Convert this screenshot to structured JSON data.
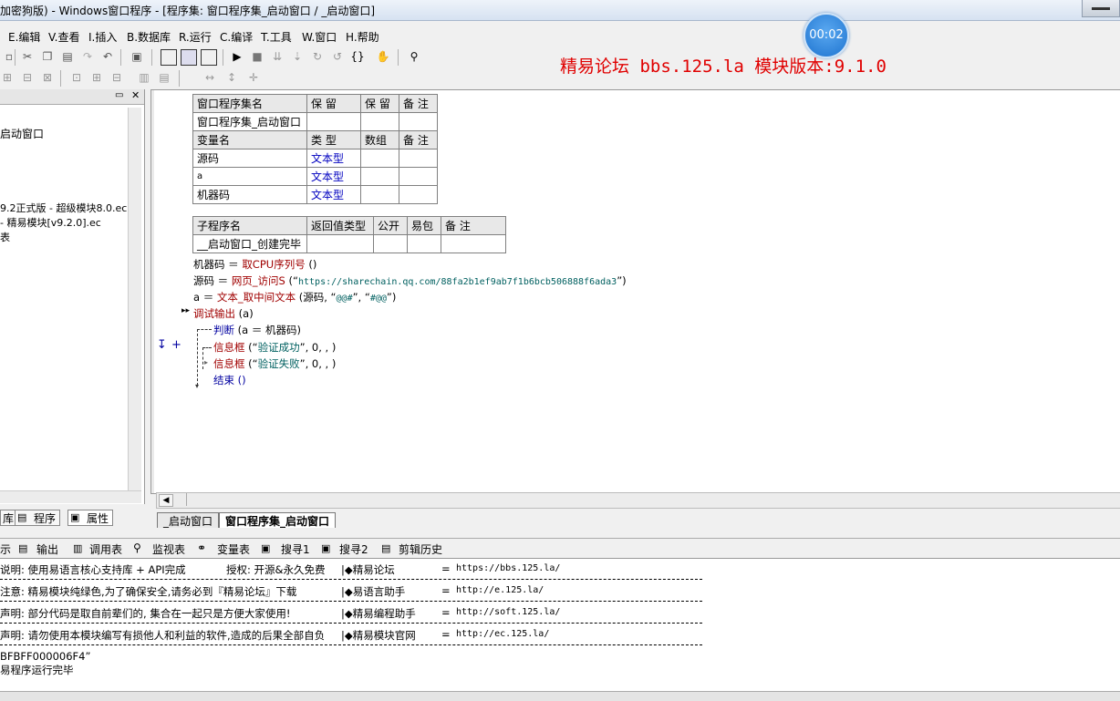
{
  "window": {
    "title": "加密狗版) - Windows窗口程序 - [程序集: 窗口程序集_启动窗口 / _启动窗口]"
  },
  "timer": "00:02",
  "menu": [
    "E.编辑",
    "V.查看",
    "I.插入",
    "B.数据库",
    "R.运行",
    "C.编译",
    "T.工具",
    "W.窗口",
    "H.帮助"
  ],
  "banner": "精易论坛 bbs.125.la 模块版本:9.1.0",
  "left_panel": {
    "lines": [
      "启动窗口",
      "9.2正式版 - 超级模块8.0.ec",
      " - 精易模块[v9.2.0].ec",
      "表"
    ],
    "tabs": [
      "库",
      "程序",
      "属性"
    ]
  },
  "editor": {
    "assembly_table": {
      "header": [
        "窗口程序集名",
        "保 留",
        "保 留",
        "备 注"
      ],
      "row": [
        "窗口程序集_启动窗口",
        "",
        "",
        ""
      ]
    },
    "var_table": {
      "header": [
        "变量名",
        "类 型",
        "数组",
        "备 注"
      ],
      "rows": [
        [
          "源码",
          "文本型",
          "",
          ""
        ],
        [
          "a",
          "文本型",
          "",
          ""
        ],
        [
          "机器码",
          "文本型",
          "",
          ""
        ]
      ]
    },
    "sub_table": {
      "header": [
        "子程序名",
        "返回值类型",
        "公开",
        "易包",
        "备 注"
      ],
      "row": [
        "__启动窗口_创建完毕",
        "",
        "",
        "",
        ""
      ]
    },
    "code": {
      "l1_a": "机器码 ＝ ",
      "l1_b": "取CPU序列号",
      "l1_c": " ()",
      "l2_a": "源码 ＝ ",
      "l2_b": "网页_访问S",
      "l2_c": " (“",
      "l2_url": "https://sharechain.qq.com/88fa2b1ef9ab7f1b6bcb506888f6ada3",
      "l2_d": "”)",
      "l3_a": "a ＝ ",
      "l3_b": "文本_取中间文本",
      "l3_c": " (源码, “",
      "l3_s1": "@@#",
      "l3_d": "”, “",
      "l3_s2": "#@@",
      "l3_e": "”)",
      "l4_a": "调试输出",
      "l4_b": " (a)",
      "l5_a": "判断",
      "l5_b": " (a ＝ 机器码)",
      "l6_a": "信息框",
      "l6_b": " (“",
      "l6_s": "验证成功",
      "l6_c": "”, 0, , )",
      "l7_a": "信息框",
      "l7_b": " (“",
      "l7_s": "验证失败",
      "l7_c": "”, 0, , )",
      "l8_a": "结束",
      "l8_b": " ()"
    },
    "tabs": [
      "_启动窗口",
      "窗口程序集_启动窗口"
    ]
  },
  "output_tabs": [
    "示",
    "输出",
    "调用表",
    "监视表",
    "变量表",
    "搜寻1",
    "搜寻2",
    "剪辑历史"
  ],
  "output": {
    "rows": [
      {
        "left": "说明: 使用易语言核心支持库 + API完成",
        "mid": "授权: 开源&永久免费",
        "name": "◆精易论坛",
        "eq": "=",
        "url": "https://bbs.125.la/"
      },
      {
        "left": "注意: 精易模块纯绿色,为了确保安全,请务必到『精易论坛』下载",
        "mid": "",
        "name": "◆易语言助手",
        "eq": "=",
        "url": "http://e.125.la/"
      },
      {
        "left": "声明: 部分代码是取自前辈们的, 集合在一起只是方便大家使用!",
        "mid": "",
        "name": "◆精易编程助手",
        "eq": "=",
        "url": "http://soft.125.la/"
      },
      {
        "left": "声明: 请勿使用本模块编写有损他人和利益的软件,造成的后果全部自负",
        "mid": "",
        "name": "◆精易模块官网",
        "eq": "=",
        "url": "http://ec.125.la/"
      }
    ],
    "tail1": "BFBFF000006F4”",
    "tail2": "易程序运行完毕"
  }
}
